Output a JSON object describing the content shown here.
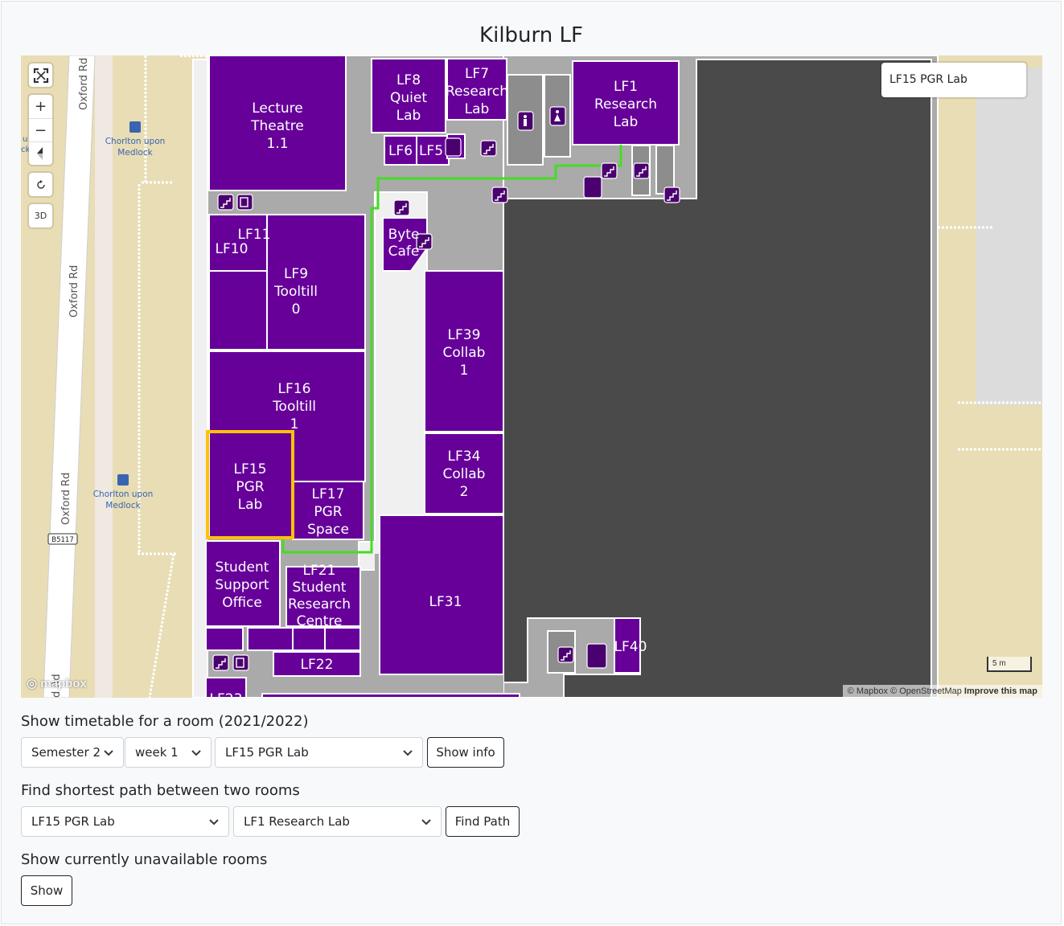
{
  "page": {
    "title": "Kilburn LF"
  },
  "map": {
    "search_value": "LF15 PGR Lab",
    "controls": {
      "zoom_in": "+",
      "zoom_out": "−",
      "three_d": "3D"
    },
    "attribution": {
      "mapbox": "© Mapbox",
      "osm": "© OpenStreetMap",
      "improve": "Improve this map"
    },
    "scale_label": "5 m",
    "logo_text": "mapbox",
    "street_labels": [
      "Oxford Rd",
      "Oxford Rd",
      "Oxford Rd",
      "d Rd"
    ],
    "bus_stops": [
      {
        "line1": "Chorlton upon",
        "line2": "Medlock"
      },
      {
        "line1": "Chorlton upon",
        "line2": "Medlock"
      }
    ],
    "road_shield": "B5117",
    "edge_fragments": [
      "u",
      "ck"
    ],
    "rooms": [
      {
        "lines": [
          "Lecture",
          "Theatre",
          "1.1"
        ]
      },
      {
        "lines": [
          "LF8",
          "Quiet",
          "Lab"
        ]
      },
      {
        "lines": [
          "LF7",
          "Research",
          "Lab"
        ]
      },
      {
        "lines": [
          "LF1",
          "Research",
          "Lab"
        ]
      },
      {
        "lines": [
          "LF6"
        ]
      },
      {
        "lines": [
          "LF5"
        ]
      },
      {
        "lines": [
          "LF11"
        ]
      },
      {
        "lines": [
          "LF10"
        ]
      },
      {
        "lines": [
          "LF9",
          "Tooltill",
          "0"
        ]
      },
      {
        "lines": [
          "Byte",
          "Cafe"
        ]
      },
      {
        "lines": [
          "LF39",
          "Collab",
          "1"
        ]
      },
      {
        "lines": [
          "LF16",
          "Tooltill",
          "1"
        ]
      },
      {
        "lines": [
          "LF15",
          "PGR",
          "Lab"
        ]
      },
      {
        "lines": [
          "LF17",
          "PGR",
          "Space"
        ]
      },
      {
        "lines": [
          "LF34",
          "Collab",
          "2"
        ]
      },
      {
        "lines": [
          "Student",
          "Support",
          "Office"
        ]
      },
      {
        "lines": [
          "LF21",
          "Student",
          "Research",
          "Centre"
        ]
      },
      {
        "lines": [
          "LF31"
        ]
      },
      {
        "lines": [
          "LF22"
        ]
      },
      {
        "lines": [
          "LF40"
        ]
      },
      {
        "lines": [
          "LF23"
        ]
      }
    ],
    "colors": {
      "room": "#660099",
      "corridor": "#aaaaaa",
      "void": "#4a4a4a",
      "highlight": "#ffc107",
      "path": "#44dd22",
      "map_bg": "#efe9e1",
      "sand": "#e8ddb5"
    }
  },
  "timetable": {
    "heading": "Show timetable for a room (2021/2022)",
    "semester": "Semester 2",
    "week": "week 1",
    "room": "LF15 PGR Lab",
    "button": "Show info"
  },
  "path": {
    "heading": "Find shortest path between two rooms",
    "from": "LF15 PGR Lab",
    "to": "LF1 Research Lab",
    "button": "Find Path"
  },
  "unavailable": {
    "heading": "Show currently unavailable rooms",
    "button": "Show"
  }
}
